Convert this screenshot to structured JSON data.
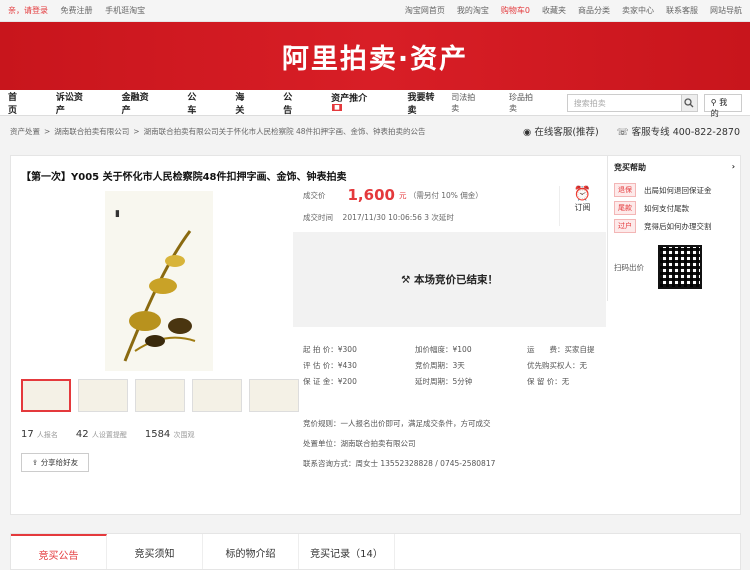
{
  "topbar": {
    "greet": "亲，请登录",
    "register": "免费注册",
    "mobile": "手机逛淘宝",
    "links": [
      "淘宝网首页",
      "我的淘宝",
      "购物车0",
      "收藏夹",
      "商品分类",
      "卖家中心",
      "联系客服",
      "网站导航"
    ]
  },
  "banner": {
    "title": "阿里拍卖·资产"
  },
  "nav": {
    "items": [
      "首页",
      "诉讼资产",
      "金融资产",
      "公车",
      "海关",
      "公告",
      "资产推介",
      "我要转卖"
    ],
    "sub1": "司法拍卖",
    "sub2": "珍品拍卖",
    "search_placeholder": "搜索拍卖",
    "mine": "我的"
  },
  "crumb": {
    "items": [
      "资产处置",
      "湖南联合拍卖有限公司",
      "湖南联合拍卖有限公司关于怀化市人民检察院 48件扣押字画、金饰、钟表拍卖的公告"
    ],
    "service": "在线客服(推荐)",
    "hotline": "客服专线 400-822-2870"
  },
  "item": {
    "title": "【第一次】Y005 关于怀化市人民检察院48件扣押字画、金饰、钟表拍卖",
    "price_label": "成交价",
    "price": "1,600",
    "unit": "元",
    "fee": "（需另付 10% 佣金）",
    "time_label": "成交时间",
    "time": "2017/11/30 10:06:56  3 次延时",
    "ended": "本场竞价已结束！",
    "remind": "订阅"
  },
  "grid": [
    "起 拍 价：¥300",
    "加价幅度：¥100",
    "运　　费：买家自提",
    "评 估 价：¥430",
    "竞价周期：3天",
    "优先购买权人：无",
    "保 证 金：¥200",
    "延时周期：5分钟",
    "保 留 价：无"
  ],
  "rules": {
    "l1": "竞价规则：一人报名出价即可，满足成交条件，方可成交",
    "l2": "处置单位：湖南联合拍卖有限公司",
    "l3": "联系咨询方式：周女士  13552328828 / 0745-2580817"
  },
  "stats": {
    "a": "17",
    "a_l": "人报名",
    "b": "42",
    "b_l": "人设置提醒",
    "c": "1584",
    "c_l": "次围观",
    "share": "分享给好友"
  },
  "help": {
    "title": "竞买帮助",
    "items": [
      {
        "tag": "退保",
        "text": "出局如何退回保证金"
      },
      {
        "tag": "尾款",
        "text": "如何支付尾款"
      },
      {
        "tag": "过户",
        "text": "竞得后如何办理交割"
      }
    ],
    "scan": "扫码出价"
  },
  "tabs": [
    "竞买公告",
    "竞买须知",
    "标的物介绍",
    "竞买记录（14）"
  ]
}
